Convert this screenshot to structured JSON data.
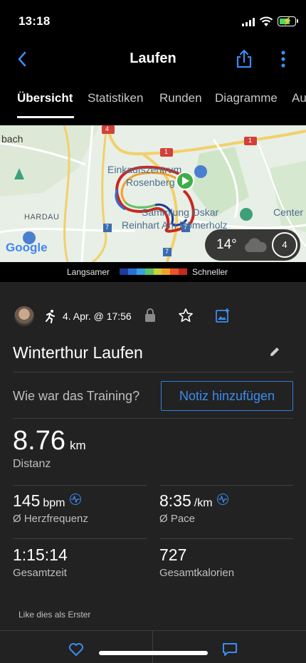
{
  "status_bar": {
    "time": "13:18"
  },
  "header": {
    "title": "Laufen",
    "back_icon": "chevron-left-icon",
    "share_icon": "share-icon",
    "more_icon": "more-vertical-icon"
  },
  "tabs": [
    {
      "label": "Übersicht",
      "active": true
    },
    {
      "label": "Statistiken",
      "active": false
    },
    {
      "label": "Runden",
      "active": false
    },
    {
      "label": "Diagramme",
      "active": false
    },
    {
      "label": "Au",
      "active": false
    }
  ],
  "map": {
    "labels": {
      "place1": "bach",
      "place2": "HARDAU",
      "place3": "Einkaufszentrum",
      "place4": "Rosenberg",
      "place5": "Sammlung Oskar",
      "place6": "Reinhart Am Römerholz",
      "place7": "Center",
      "google": "Google",
      "road_1a": "1",
      "road_1b": "1",
      "road_4": "4",
      "road_7a": "7",
      "road_7b": "7",
      "road_7c": "7"
    },
    "weather": {
      "temperature": "14°",
      "wind": "4"
    }
  },
  "legend": {
    "slow": "Langsamer",
    "fast": "Schneller",
    "colors": [
      "#1d3b9a",
      "#2a6fd6",
      "#3aa0e0",
      "#5cc36a",
      "#c7d337",
      "#f2a02c",
      "#e8552a",
      "#c8281e"
    ]
  },
  "activity": {
    "date": "4. Apr. @ 17:56",
    "name": "Winterthur Laufen",
    "training_question": "Wie war das Training?",
    "note_button": "Notiz hinzufügen"
  },
  "stats": {
    "distance": {
      "value": "8.76",
      "unit": "km",
      "label": "Distanz"
    },
    "heart_rate": {
      "value": "145",
      "unit": "bpm",
      "label": "Ø Herzfrequenz"
    },
    "pace": {
      "value": "8:35",
      "unit": "/km",
      "label": "Ø Pace"
    },
    "total_time": {
      "value": "1:15:14",
      "label": "Gesamtzeit"
    },
    "calories": {
      "value": "727",
      "label": "Gesamtkalorien"
    }
  },
  "social": {
    "like_text": "Like dies als Erster"
  }
}
